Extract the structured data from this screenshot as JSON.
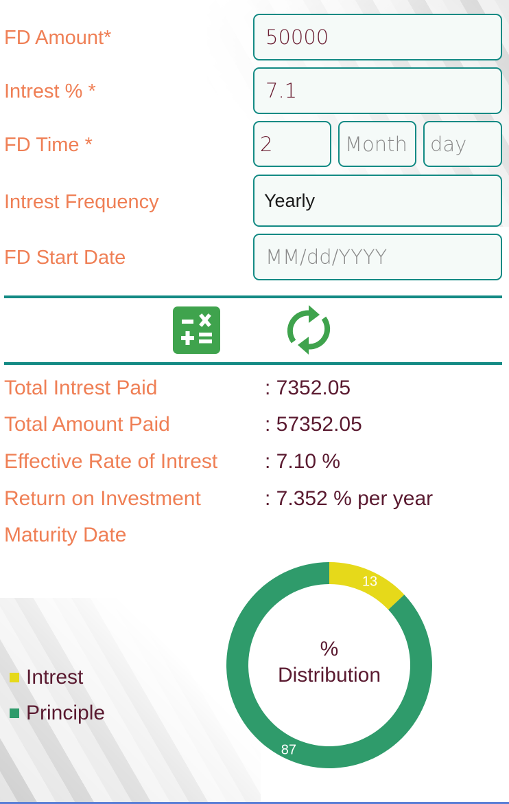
{
  "form": {
    "fd_amount": {
      "label": "FD Amount*",
      "value": "50000"
    },
    "interest": {
      "label": "Intrest % *",
      "value": "7.1"
    },
    "fd_time": {
      "label": "FD Time *",
      "years_value": "2",
      "month_placeholder": "Month",
      "day_placeholder": "day"
    },
    "frequency": {
      "label": "Intrest Frequency",
      "selected": "Yearly"
    },
    "start_date": {
      "label": "FD Start Date",
      "placeholder": "MM/dd/YYYY"
    }
  },
  "actions": {
    "calculate_icon": "calculator-icon",
    "reset_icon": "refresh-icon"
  },
  "results": [
    {
      "label": "Total Intrest Paid",
      "value": ": 7352.05"
    },
    {
      "label": "Total Amount Paid",
      "value": ": 57352.05"
    },
    {
      "label": "Effective Rate of Intrest",
      "value": ": 7.10 %"
    },
    {
      "label": "Return on Investment",
      "value": ": 7.352 % per year"
    },
    {
      "label": "Maturity Date",
      "value": ""
    }
  ],
  "colors": {
    "label": "#ef7f55",
    "value": "#5a1a30",
    "accent": "#138a84",
    "interest": "#e6d91a",
    "principle": "#2f9b6b",
    "icon_green": "#3fa34d"
  },
  "chart_data": {
    "type": "pie",
    "subtype": "donut",
    "title": "% Distribution",
    "center_text_line1": "%",
    "center_text_line2": "Distribution",
    "categories": [
      "Intrest",
      "Principle"
    ],
    "values": [
      13,
      87
    ],
    "colors": [
      "#e6d91a",
      "#2f9b6b"
    ],
    "legend": {
      "placement": "left",
      "entries": [
        "Intrest",
        "Principle"
      ]
    }
  }
}
